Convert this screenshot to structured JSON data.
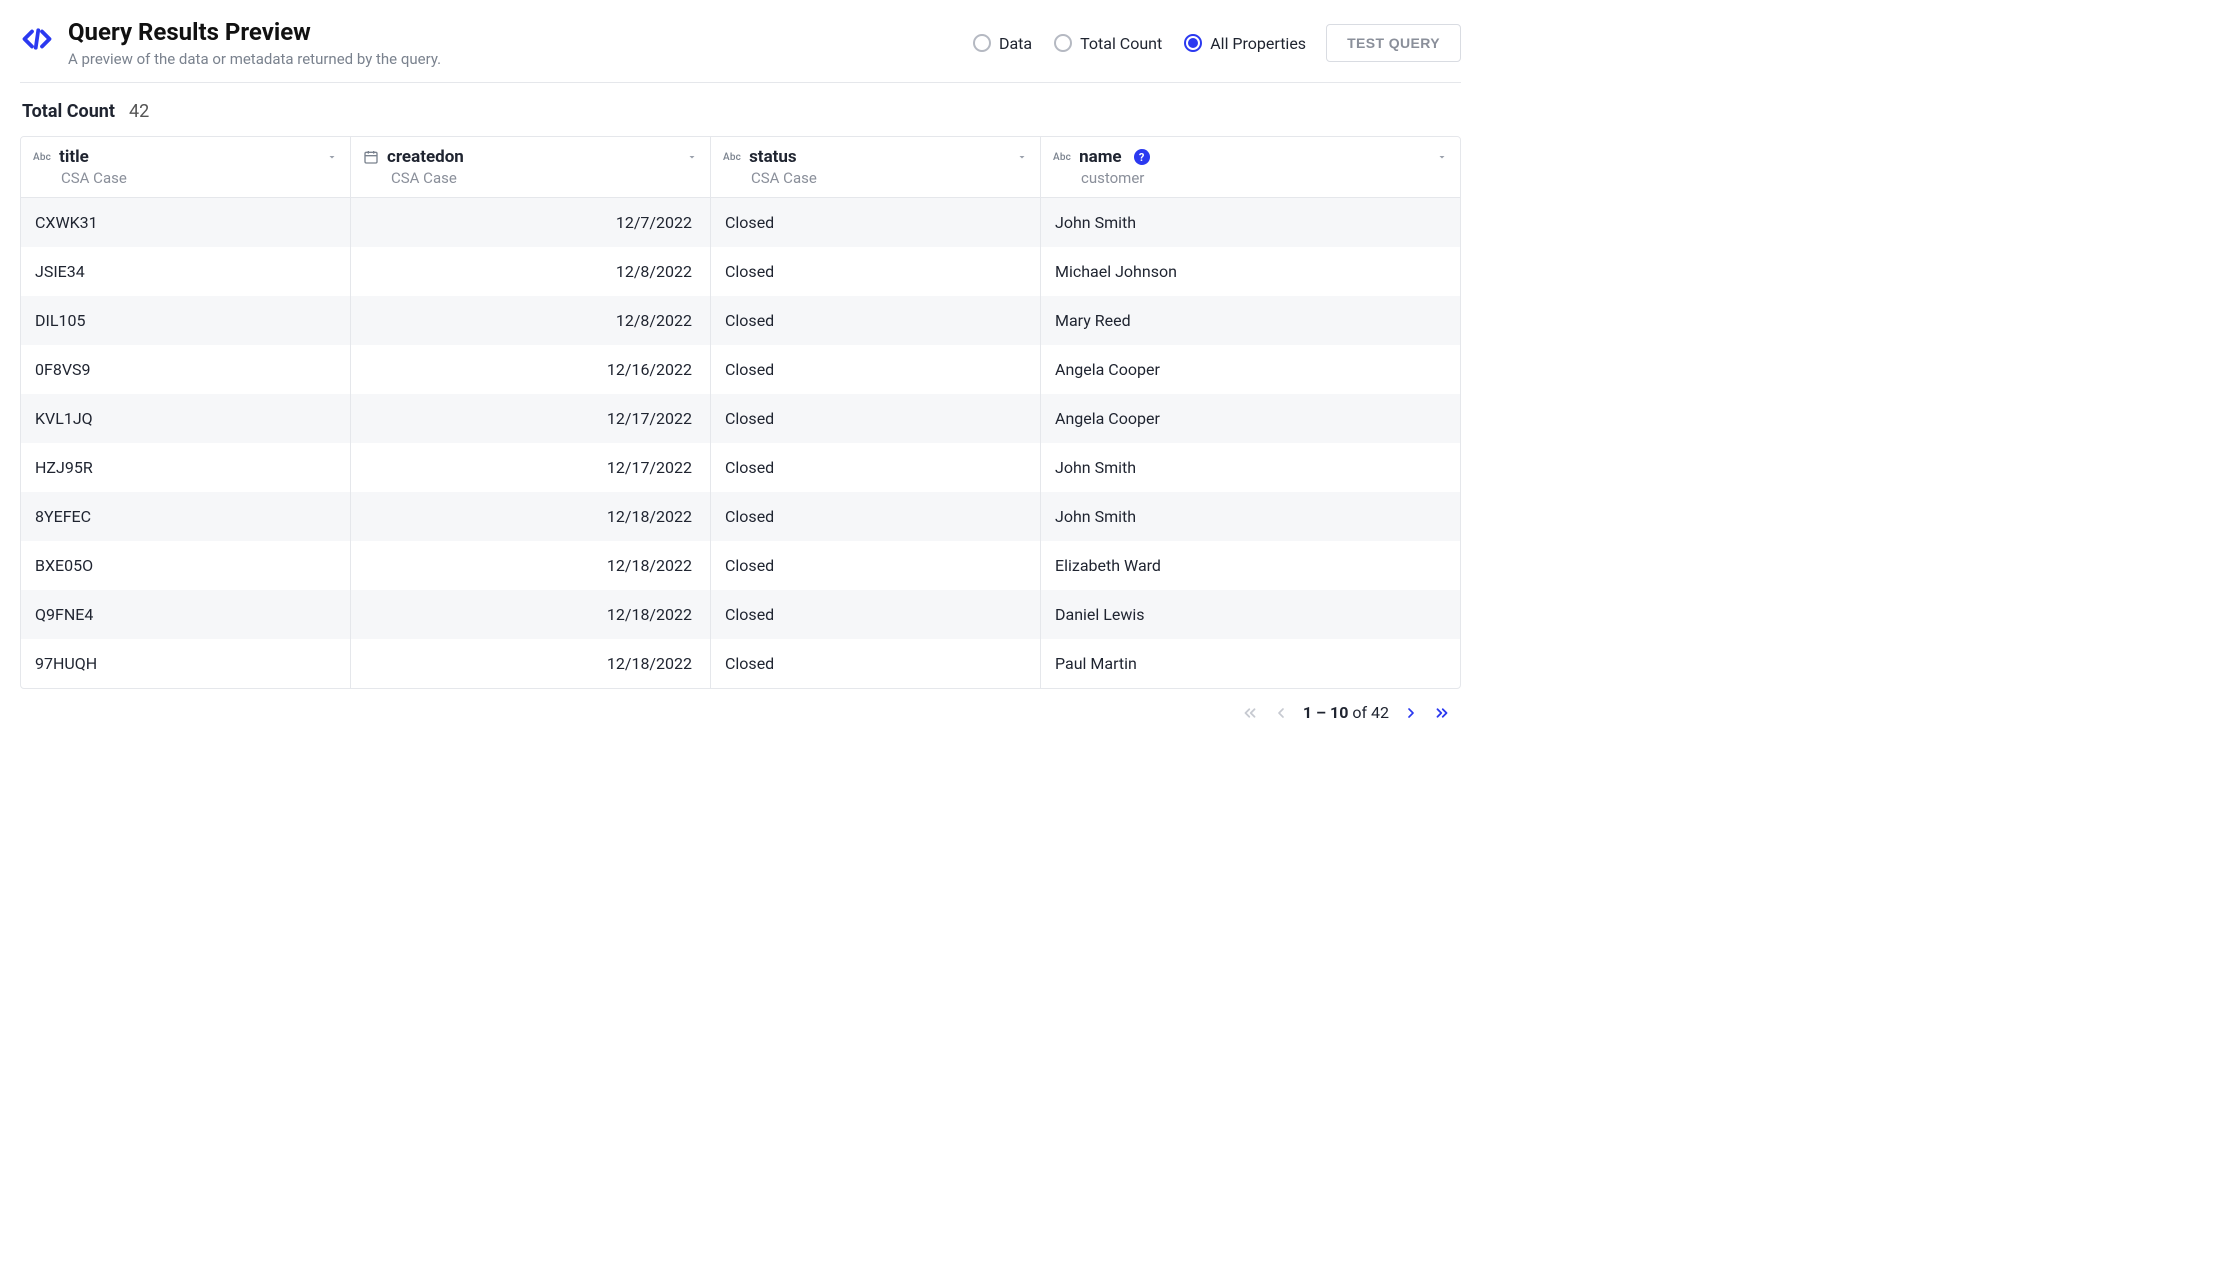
{
  "header": {
    "title": "Query Results Preview",
    "subtitle": "A preview of the data or metadata returned by the query."
  },
  "view_modes": {
    "options": [
      "Data",
      "Total Count",
      "All Properties"
    ],
    "selected": "All Properties"
  },
  "test_button_label": "TEST QUERY",
  "total_count": {
    "label": "Total Count",
    "value": "42"
  },
  "columns": [
    {
      "key": "title",
      "name": "title",
      "sub": "CSA Case",
      "type": "Abc",
      "align": "left",
      "width_class": "col-title",
      "info": false
    },
    {
      "key": "createdon",
      "name": "createdon",
      "sub": "CSA Case",
      "type": "date",
      "align": "right",
      "width_class": "col-created",
      "info": false
    },
    {
      "key": "status",
      "name": "status",
      "sub": "CSA Case",
      "type": "Abc",
      "align": "left",
      "width_class": "col-status",
      "info": false
    },
    {
      "key": "name",
      "name": "name",
      "sub": "customer",
      "type": "Abc",
      "align": "left",
      "width_class": "col-name",
      "info": true
    }
  ],
  "rows": [
    {
      "title": "CXWK31",
      "createdon": "12/7/2022",
      "status": "Closed",
      "name": "John Smith"
    },
    {
      "title": "JSIE34",
      "createdon": "12/8/2022",
      "status": "Closed",
      "name": "Michael Johnson"
    },
    {
      "title": "DIL105",
      "createdon": "12/8/2022",
      "status": "Closed",
      "name": "Mary Reed"
    },
    {
      "title": "0F8VS9",
      "createdon": "12/16/2022",
      "status": "Closed",
      "name": "Angela Cooper"
    },
    {
      "title": "KVL1JQ",
      "createdon": "12/17/2022",
      "status": "Closed",
      "name": "Angela Cooper"
    },
    {
      "title": "HZJ95R",
      "createdon": "12/17/2022",
      "status": "Closed",
      "name": "John Smith"
    },
    {
      "title": "8YEFEC",
      "createdon": "12/18/2022",
      "status": "Closed",
      "name": "John Smith"
    },
    {
      "title": "BXE05O",
      "createdon": "12/18/2022",
      "status": "Closed",
      "name": "Elizabeth Ward"
    },
    {
      "title": "Q9FNE4",
      "createdon": "12/18/2022",
      "status": "Closed",
      "name": "Daniel Lewis"
    },
    {
      "title": "97HUQH",
      "createdon": "12/18/2022",
      "status": "Closed",
      "name": "Paul Martin"
    }
  ],
  "pagination": {
    "range": "1 – 10",
    "of_label": "of",
    "total": "42",
    "prev_enabled": false,
    "next_enabled": true
  }
}
